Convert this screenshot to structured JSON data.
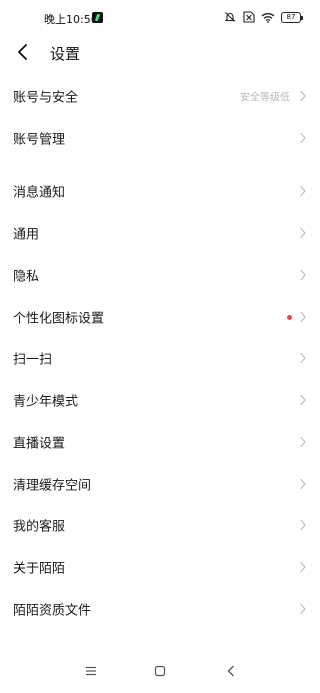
{
  "status_bar": {
    "time": "晚上10:56",
    "battery": "87",
    "icons": [
      "app-notification-icon",
      "mute-bell-icon",
      "sim-cancel-icon",
      "wifi-icon",
      "battery-icon"
    ]
  },
  "header": {
    "title": "设置",
    "back_icon": "chevron-left-icon"
  },
  "settings": {
    "items": [
      {
        "label": "账号与安全",
        "value": "安全等级低"
      },
      {
        "label": "账号管理"
      },
      {
        "label": "消息通知"
      },
      {
        "label": "通用"
      },
      {
        "label": "隐私"
      },
      {
        "label": "个性化图标设置",
        "badge": "red-dot"
      },
      {
        "label": "扫一扫"
      },
      {
        "label": "青少年模式"
      },
      {
        "label": "直播设置"
      },
      {
        "label": "清理缓存空间"
      },
      {
        "label": "我的客服"
      },
      {
        "label": "关于陌陌"
      },
      {
        "label": "陌陌资质文件"
      }
    ]
  },
  "colors": {
    "background": "#ffffff",
    "text": "#1a1a1a",
    "secondary_text": "#b8b8b8",
    "chevron": "#bdbdbd",
    "badge": "#ef4444"
  },
  "nav_bar": {
    "icons": [
      "menu-icon",
      "home-square-icon",
      "back-triangle-icon"
    ]
  }
}
